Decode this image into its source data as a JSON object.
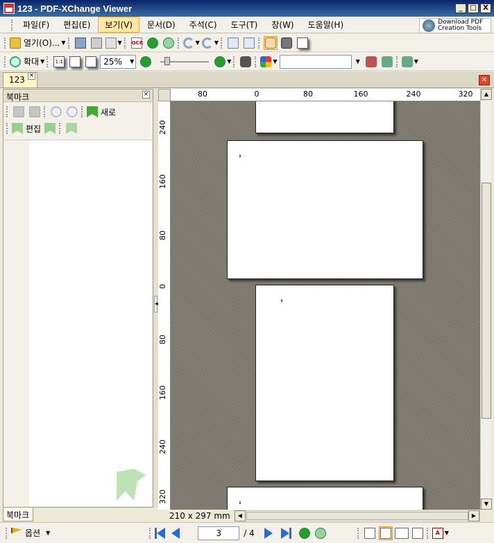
{
  "window": {
    "title": "123 - PDF-XChange Viewer",
    "minimize": "_",
    "maximize": "□",
    "close": "X"
  },
  "menu": {
    "items": [
      {
        "label": "파일(F)"
      },
      {
        "label": "편집(E)"
      },
      {
        "label": "보기(V)"
      },
      {
        "label": "문서(D)"
      },
      {
        "label": "주석(C)"
      },
      {
        "label": "도구(T)"
      },
      {
        "label": "창(W)"
      },
      {
        "label": "도움말(H)"
      }
    ],
    "active_index": 2
  },
  "promo": {
    "line1": "Download PDF",
    "line2": "Creation Tools"
  },
  "toolbar1": {
    "open_label": "열기(O)...",
    "ocr_label": "OCR"
  },
  "toolbar2": {
    "zoom_label": "확대",
    "actual_size": "1:1",
    "zoom_value": "25%",
    "search_value": ""
  },
  "tabs": {
    "document_tab": "123",
    "close_x": "×"
  },
  "bookmarks": {
    "title": "북마크",
    "close_x": "×",
    "new_label": "새로",
    "edit_label": "편집",
    "panel_tab": "북마크"
  },
  "rulers": {
    "top": [
      "80",
      "0",
      "80",
      "160",
      "240",
      "320"
    ],
    "left": [
      "240",
      "160",
      "80",
      "0",
      "80",
      "160",
      "240",
      "320"
    ]
  },
  "status": {
    "page_size": "210 x 297 mm",
    "options_label": "옵션",
    "current_page": "3",
    "total_pages": "/ 4"
  },
  "colors": {
    "canvas": "#7b776f",
    "accent": "#ffd98a",
    "nav_blue": "#2a6bd0"
  }
}
